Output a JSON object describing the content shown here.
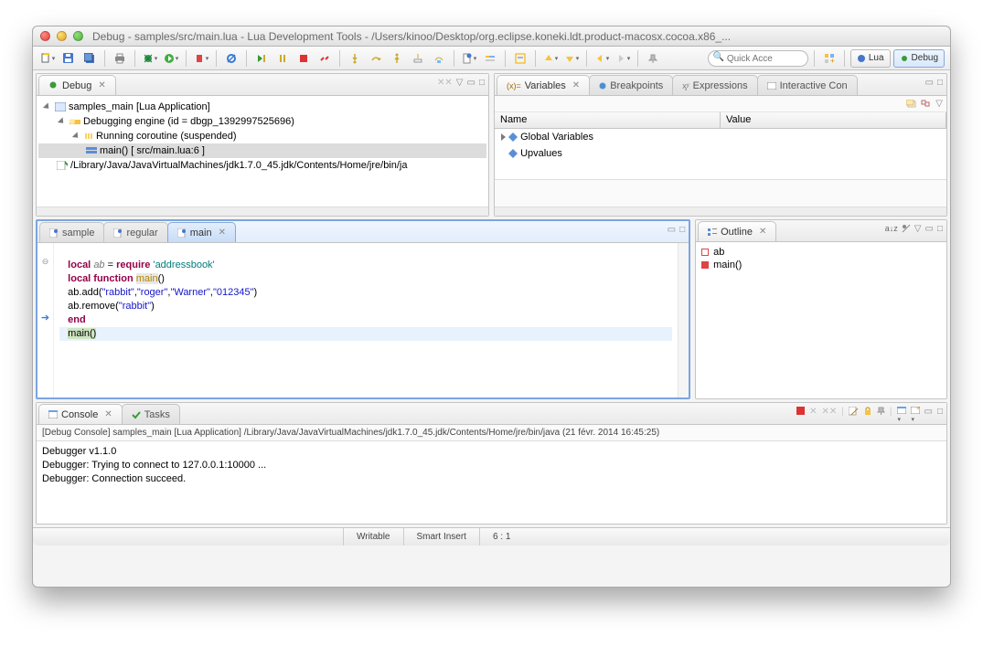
{
  "window": {
    "title": "Debug - samples/src/main.lua - Lua Development Tools - /Users/kinoo/Desktop/org.eclipse.koneki.ldt.product-macosx.cocoa.x86_..."
  },
  "quick_access_placeholder": "Quick Acce",
  "perspectives": {
    "lua": "Lua",
    "debug": "Debug"
  },
  "panel_debug": {
    "title": "Debug",
    "nodes": {
      "app": "samples_main [Lua Application]",
      "engine": "Debugging engine (id = dbgp_1392997525696)",
      "coroutine": "Running coroutine (suspended)",
      "frame": "main()   [ src/main.lua:6 ]",
      "jvm": "/Library/Java/JavaVirtualMachines/jdk1.7.0_45.jdk/Contents/Home/jre/bin/ja"
    }
  },
  "panel_vars": {
    "tabs": {
      "variables": "Variables",
      "breakpoints": "Breakpoints",
      "expressions": "Expressions",
      "interactive": "Interactive Con"
    },
    "columns": {
      "name": "Name",
      "value": "Value"
    },
    "rows": {
      "globals": "Global Variables",
      "upvalues": "Upvalues"
    }
  },
  "editor": {
    "tabs": {
      "sample": "sample",
      "regular": "regular",
      "main": "main"
    },
    "code": {
      "l1a": "local",
      "l1b": "ab",
      "l1c": "= ",
      "l1d": "require",
      "l1e": "'addressbook'",
      "l2a": "local function",
      "l2b": "main",
      "l2c": "()",
      "l3": "   ab.add(",
      "l3s1": "\"rabbit\"",
      "l3m": ",",
      "l3s2": "\"roger\"",
      "l3s3": "\"Warner\"",
      "l3s4": "\"012345\"",
      "l3e": ")",
      "l4": "   ab.remove(",
      "l4s": "\"rabbit\"",
      "l4e": ")",
      "l5": "end",
      "l6a": "main",
      "l6b": "()"
    }
  },
  "outline": {
    "title": "Outline",
    "items": {
      "ab": "ab",
      "main": "main()"
    }
  },
  "console": {
    "tabs": {
      "console": "Console",
      "tasks": "Tasks"
    },
    "header": "[Debug Console] samples_main [Lua Application] /Library/Java/JavaVirtualMachines/jdk1.7.0_45.jdk/Contents/Home/jre/bin/java (21 févr. 2014 16:45:25)",
    "lines": {
      "l1": "Debugger v1.1.0",
      "l2": "Debugger: Trying to connect to 127.0.0.1:10000 ...",
      "l3": "Debugger: Connection succeed."
    }
  },
  "status": {
    "writable": "Writable",
    "smart": "Smart Insert",
    "pos": "6 : 1"
  }
}
